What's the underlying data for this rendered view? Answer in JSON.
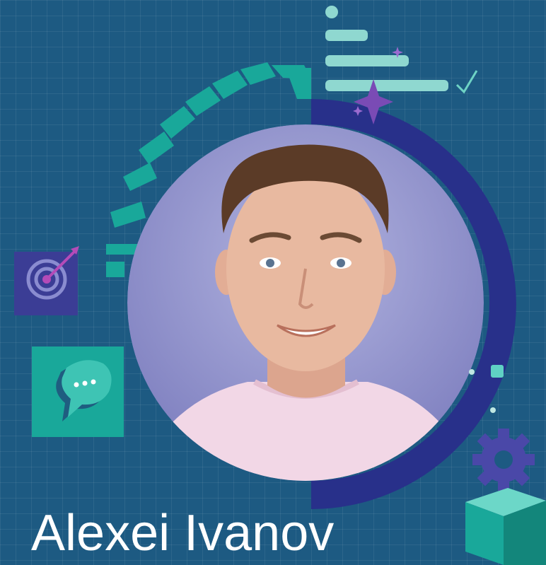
{
  "person": {
    "name": "Alexei Ivanov"
  },
  "icons": [
    "target-dart-icon",
    "chat-bubble-icon",
    "gear-icon",
    "checkmark-icon",
    "sparkle-icon",
    "cube-icon"
  ],
  "colors": {
    "background": "#1d5a82",
    "teal": "#19a89a",
    "navy": "#2a2f86",
    "lavender": "#8f90c9",
    "purple": "#7a4bb5",
    "skin": "#e8b9a0",
    "shirt": "#f2d7e6",
    "hair": "#5b3b27"
  }
}
